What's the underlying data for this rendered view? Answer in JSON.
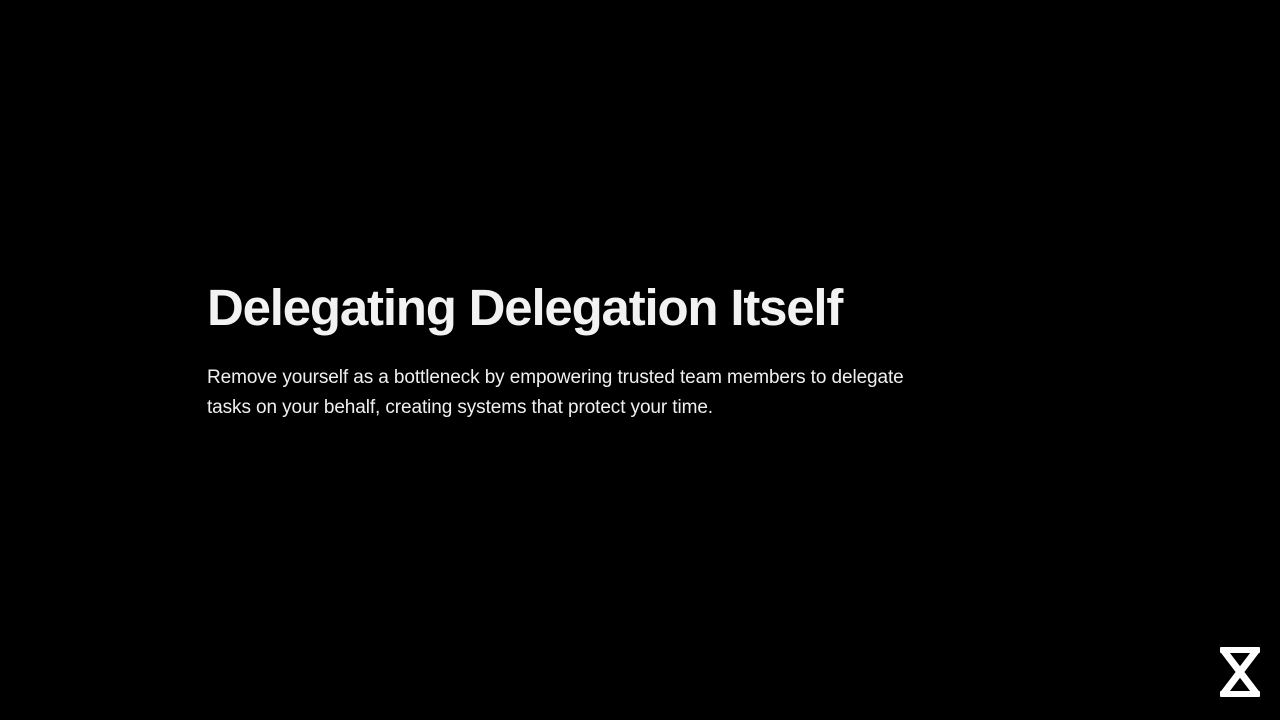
{
  "slide": {
    "title": "Delegating Delegation Itself",
    "subtitle": "Remove yourself as a bottleneck by empowering trusted team members to delegate tasks on your behalf, creating systems that protect your time."
  },
  "logo": {
    "icon": "hourglass-x-logo-icon"
  },
  "colors": {
    "background": "#000000",
    "text": "#f2f2f2"
  }
}
